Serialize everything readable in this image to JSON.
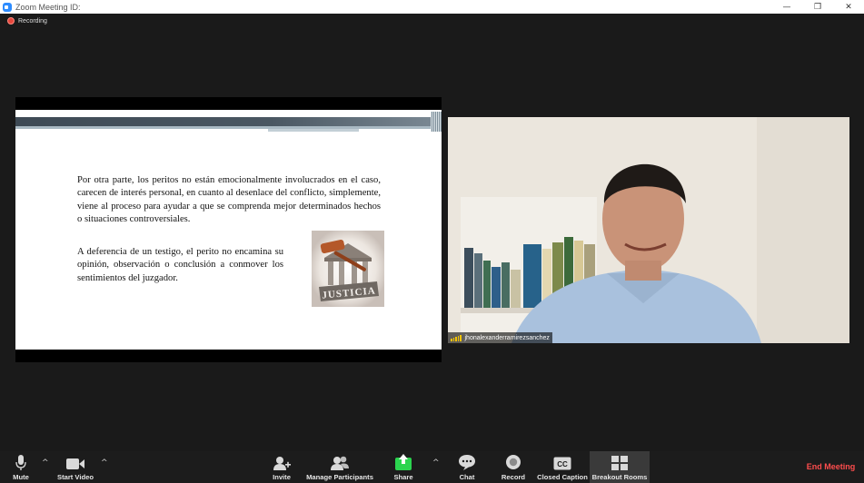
{
  "window": {
    "title": "Zoom Meeting ID:",
    "controls": {
      "minimize": "—",
      "restore": "❒",
      "close": "✕"
    }
  },
  "recording": {
    "label": "Recording"
  },
  "slide": {
    "paragraph1": "Por otra parte, los peritos no están emocionalmente involucrados en el caso, carecen de interés personal, en cuanto al desenlace del conflicto, simplemente,  viene al proceso para ayudar a que se comprenda mejor determinados hechos o situaciones controversiales.",
    "paragraph2": "A deferencia de un testigo, el perito no encamina su opinión, observación o conclusión a conmover los sentimientos del juzgador.",
    "justicia_image_text": "JUSTICIA"
  },
  "participant": {
    "name": "jhonalexanderramirezsanchez"
  },
  "toolbar": {
    "mute": "Mute",
    "start_video": "Start Video",
    "invite": "Invite",
    "manage_participants": "Manage Participants",
    "share": "Share",
    "chat": "Chat",
    "record": "Record",
    "closed_caption": "Closed Caption",
    "breakout_rooms": "Breakout Rooms",
    "end_meeting": "End Meeting",
    "caret": "^"
  },
  "colors": {
    "share_green": "#2bd44f",
    "end_red": "#ff4d4d",
    "signal_yellow": "#f5c400"
  }
}
